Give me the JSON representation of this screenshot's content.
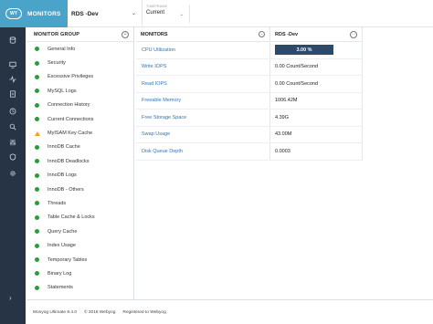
{
  "app": {
    "logo_text": "WY",
    "title": "MONITORS"
  },
  "server_select": {
    "value": "RDS -Dev"
  },
  "timeframe": {
    "label": "TIMEFRAME",
    "value": "Current"
  },
  "sidebar_icons": [
    "database-icon",
    "monitor-icon",
    "activity-icon",
    "document-icon",
    "clock-icon",
    "search-icon",
    "sliders-icon",
    "shield-icon",
    "gear-icon"
  ],
  "monitor_group": {
    "header": "MONITOR GROUP",
    "items": [
      {
        "label": "General Info",
        "status": "ok"
      },
      {
        "label": "Security",
        "status": "ok"
      },
      {
        "label": "Excessive Privileges",
        "status": "ok"
      },
      {
        "label": "MySQL Logs",
        "status": "ok"
      },
      {
        "label": "Connection History",
        "status": "ok"
      },
      {
        "label": "Current Connections",
        "status": "ok"
      },
      {
        "label": "MyISAM Key Cache",
        "status": "warning"
      },
      {
        "label": "InnoDB Cache",
        "status": "ok"
      },
      {
        "label": "InnoDB Deadlocks",
        "status": "ok"
      },
      {
        "label": "InnoDB Logs",
        "status": "ok"
      },
      {
        "label": "InnoDB - Others",
        "status": "ok"
      },
      {
        "label": "Threads",
        "status": "ok"
      },
      {
        "label": "Table Cache & Locks",
        "status": "ok"
      },
      {
        "label": "Query Cache",
        "status": "ok"
      },
      {
        "label": "Index Usage",
        "status": "ok"
      },
      {
        "label": "Temporary Tables",
        "status": "ok"
      },
      {
        "label": "Binary Log",
        "status": "ok"
      },
      {
        "label": "Statements",
        "status": "ok"
      }
    ]
  },
  "monitors": {
    "header": "MONITORS",
    "server_header": "RDS -Dev",
    "rows": [
      {
        "name": "CPU Utilization",
        "value": "3.00 %",
        "progress": 0.03
      },
      {
        "name": "Write IOPS",
        "value": "0.00 Count/Second"
      },
      {
        "name": "Read IOPS",
        "value": "0.00 Count/Second"
      },
      {
        "name": "Freeable Memory",
        "value": "1006.42M"
      },
      {
        "name": "Free Storage Space",
        "value": "4.39G"
      },
      {
        "name": "Swap Usage",
        "value": "43.00M"
      },
      {
        "name": "Disk Queue Depth",
        "value": "0.0003"
      }
    ]
  },
  "footer": {
    "version": "Monyog Ultimate 8.4.0",
    "copyright": "© 2018 Webyog",
    "registration": "Registered to Webyog"
  },
  "colors": {
    "brand": "#4aa3c9",
    "rail": "#263445",
    "ok": "#2e9a3f",
    "warning": "#f0a21b",
    "link": "#2f76b8",
    "bar": "#2d4a6a"
  }
}
